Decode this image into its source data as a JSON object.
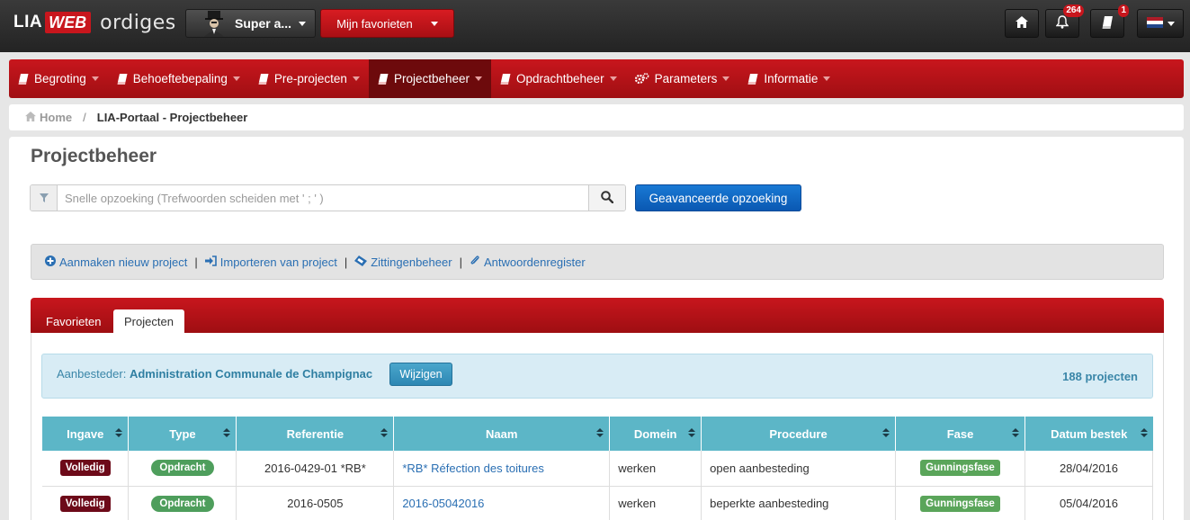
{
  "brand": {
    "lia": "LIA",
    "web": "WEB",
    "ordiges": "ordiges"
  },
  "topbar": {
    "user_label": "Super a...",
    "favorites_label": "Mijn favorieten",
    "notifications_count": "264",
    "docs_count": "1"
  },
  "nav": {
    "items": [
      {
        "label": "Begroting"
      },
      {
        "label": "Behoeftebepaling"
      },
      {
        "label": "Pre-projecten"
      },
      {
        "label": "Projectbeheer"
      },
      {
        "label": "Opdrachtbeheer"
      },
      {
        "label": "Parameters"
      },
      {
        "label": "Informatie"
      }
    ]
  },
  "breadcrumb": {
    "home": "Home",
    "separator": "/",
    "current": "LIA-Portaal - Projectbeheer"
  },
  "page": {
    "title": "Projectbeheer"
  },
  "search": {
    "placeholder": "Snelle opzoeking (Trefwoorden scheiden met ' ; ' )",
    "advanced_label": "Geavanceerde opzoeking"
  },
  "actions": [
    {
      "label": "Aanmaken nieuw project"
    },
    {
      "label": "Importeren van project"
    },
    {
      "label": "Zittingenbeheer"
    },
    {
      "label": "Antwoordenregister"
    }
  ],
  "action_separator": "|",
  "tabs": [
    {
      "label": "Favorieten"
    },
    {
      "label": "Projecten"
    }
  ],
  "aanbesteder": {
    "label": "Aanbesteder:",
    "name": "Administration Communale de Champignac",
    "button": "Wijzigen",
    "count": "188 projecten"
  },
  "table": {
    "headers": [
      "Ingave",
      "Type",
      "Referentie",
      "Naam",
      "Domein",
      "Procedure",
      "Fase",
      "Datum bestek"
    ],
    "rows": [
      {
        "ingave": "Volledig",
        "type": "Opdracht",
        "referentie": "2016-0429-01 *RB*",
        "naam": "*RB* Réfection des toitures",
        "domein": "werken",
        "procedure": "open aanbesteding",
        "fase": "Gunningsfase",
        "datum": "28/04/2016"
      },
      {
        "ingave": "Volledig",
        "type": "Opdracht",
        "referentie": "2016-0505",
        "naam": "2016-05042016",
        "domein": "werken",
        "procedure": "beperkte aanbesteding",
        "fase": "Gunningsfase",
        "datum": "05/04/2016"
      }
    ]
  },
  "colors": {
    "brand_red": "#c8161d",
    "nav_active": "#6d0a0c",
    "table_header": "#5cb6c7",
    "link": "#2a6fb3"
  }
}
